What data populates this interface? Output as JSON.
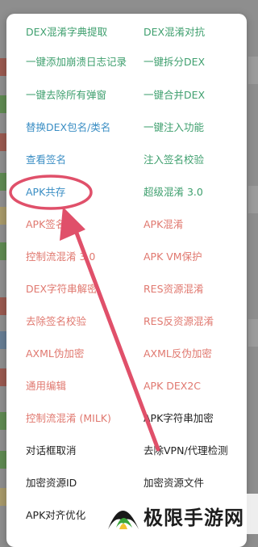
{
  "dialog": {
    "left_column": [
      {
        "label": "DEX混淆字典提取",
        "color": "green"
      },
      {
        "label": "一键添加崩溃日志记录",
        "color": "green"
      },
      {
        "label": "一键去除所有弹窗",
        "color": "green"
      },
      {
        "label": "替换DEX包名/类名",
        "color": "blue"
      },
      {
        "label": "查看签名",
        "color": "blue"
      },
      {
        "label": "APK共存",
        "color": "blue"
      },
      {
        "label": "APK签名",
        "color": "red"
      },
      {
        "label": "控制流混淆 3.0",
        "color": "red"
      },
      {
        "label": "DEX字符串解密",
        "color": "red"
      },
      {
        "label": "去除签名校验",
        "color": "red"
      },
      {
        "label": "AXML伪加密",
        "color": "red"
      },
      {
        "label": "通用编辑",
        "color": "red"
      },
      {
        "label": "控制流混淆 (MILK)",
        "color": "red"
      },
      {
        "label": "对话框取消",
        "color": "black"
      },
      {
        "label": "加密资源ID",
        "color": "black"
      },
      {
        "label": "APK对齐优化",
        "color": "black"
      }
    ],
    "right_column": [
      {
        "label": "DEX混淆对抗",
        "color": "green"
      },
      {
        "label": "一键拆分DEX",
        "color": "green"
      },
      {
        "label": "一键合并DEX",
        "color": "green"
      },
      {
        "label": "一键注入功能",
        "color": "green"
      },
      {
        "label": "注入签名校验",
        "color": "green"
      },
      {
        "label": "超级混淆 3.0",
        "color": "green"
      },
      {
        "label": "APK混淆",
        "color": "red"
      },
      {
        "label": "APK VM保护",
        "color": "red"
      },
      {
        "label": "RES资源混淆",
        "color": "red"
      },
      {
        "label": "RES反资源混淆",
        "color": "red"
      },
      {
        "label": "AXML反伪加密",
        "color": "red"
      },
      {
        "label": "APK DEX2C",
        "color": "red"
      },
      {
        "label": "APK字符串加密",
        "color": "black"
      },
      {
        "label": "去除VPN/代理检测",
        "color": "black"
      },
      {
        "label": "加密资源文件",
        "color": "black"
      },
      {
        "label": ""
      }
    ]
  },
  "annotation": {
    "circled_item": "APK共存",
    "color": "#e0506a"
  },
  "watermark": {
    "text": "极限手游网"
  },
  "colors": {
    "green": "#3e9f6e",
    "blue": "#3a8ec4",
    "red": "#e0786f",
    "black": "#222222"
  }
}
